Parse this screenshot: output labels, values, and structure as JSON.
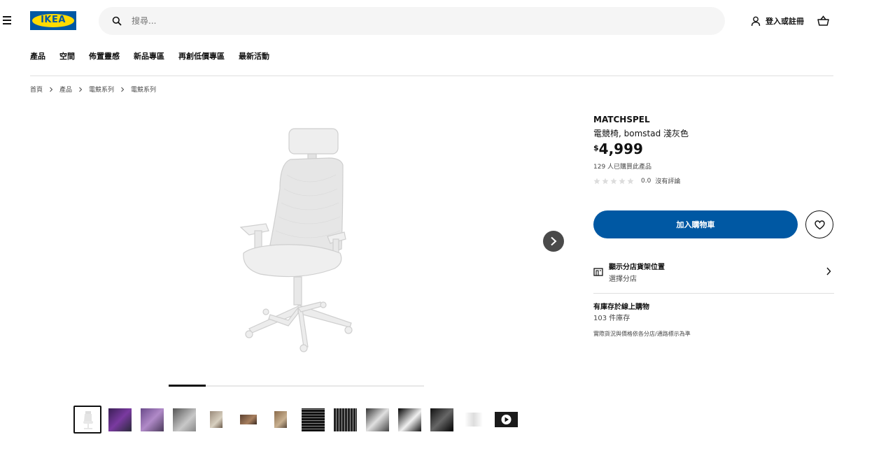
{
  "header": {
    "search_placeholder": "搜尋...",
    "login_label": "登入或註冊",
    "logo_text": "IKEA"
  },
  "nav": [
    "產品",
    "空間",
    "佈置靈感",
    "新品專區",
    "再創低價專區",
    "最新活動"
  ],
  "breadcrumb": [
    "首頁",
    "產品",
    "電競系列",
    "電競系列"
  ],
  "product": {
    "name": "MATCHSPEL",
    "description": "電競椅, bomstad 淺灰色",
    "currency": "$",
    "price": "4,999",
    "bought": "129 人已購買此產品",
    "rating_score": "0.0",
    "rating_count": 0,
    "rating_text": "沒有評論",
    "add_to_cart": "加入購物車",
    "store_title": "顯示分店貨架位置",
    "store_subtitle": "選擇分店",
    "stock_title": "有庫存於線上購物",
    "stock_count": "103 件庫存",
    "note": "實際貨況與價格依各分店/通路標示為準"
  },
  "gallery": {
    "progress_fraction": 0.145,
    "thumbnails": [
      {
        "kind": "chair-white",
        "selected": true
      },
      {
        "kind": "room-purple",
        "selected": false
      },
      {
        "kind": "room-purple-2",
        "selected": false
      },
      {
        "kind": "room-desk",
        "selected": false
      },
      {
        "kind": "photo-small",
        "selected": false
      },
      {
        "kind": "photo-wide",
        "selected": false
      },
      {
        "kind": "photo-small-2",
        "selected": false
      },
      {
        "kind": "grid-dark",
        "selected": false
      },
      {
        "kind": "grid-chair",
        "selected": false
      },
      {
        "kind": "grid-seat",
        "selected": false
      },
      {
        "kind": "dark-detail",
        "selected": false
      },
      {
        "kind": "dark-base",
        "selected": false
      },
      {
        "kind": "chairs-line",
        "selected": false
      },
      {
        "kind": "video",
        "selected": false
      }
    ]
  },
  "colors": {
    "brand_blue": "#0058a3",
    "brand_yellow": "#ffdb00",
    "text_dark": "#111111"
  }
}
